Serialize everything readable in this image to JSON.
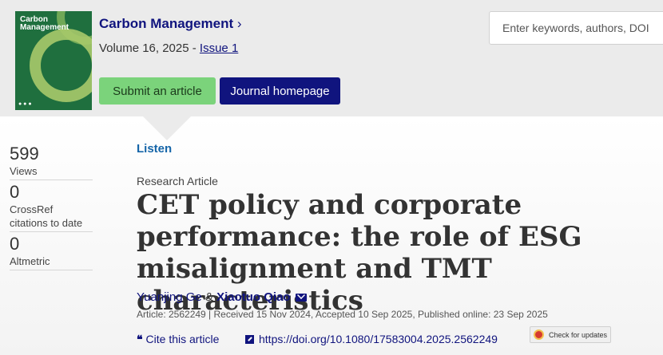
{
  "journal": {
    "name": "Carbon Management",
    "chevron": "›",
    "volume_prefix": "Volume 16, 2025 - ",
    "issue": "Issue 1",
    "cover_text": "Carbon Management",
    "submit_label": "Submit an article",
    "homepage_label": "Journal homepage"
  },
  "search": {
    "placeholder": "Enter keywords, authors, DOI"
  },
  "metrics": [
    {
      "value": "599",
      "label": "Views"
    },
    {
      "value": "0",
      "label": "CrossRef citations to date"
    },
    {
      "value": "0",
      "label": "Altmetric"
    }
  ],
  "article": {
    "listen": "Listen",
    "type": "Research Article",
    "title": "CET policy and corporate performance: the role of ESG misalignment and TMT characteristics",
    "author1": "Yuanjing Ge",
    "amp": "&",
    "author2": "Xiaotuo Qiao",
    "meta": "Article: 2562249 | Received 15 Nov 2024, Accepted 10 Sep 2025, Published online: 23 Sep 2025",
    "cite_label": "Cite this article",
    "cite_icon": "❝",
    "doi": "https://doi.org/10.1080/17583004.2025.2562249",
    "check_updates": "Check for updates"
  },
  "colors": {
    "brand": "#10147e",
    "accent_green": "#7bd37b",
    "link_blue": "#1565a8"
  }
}
